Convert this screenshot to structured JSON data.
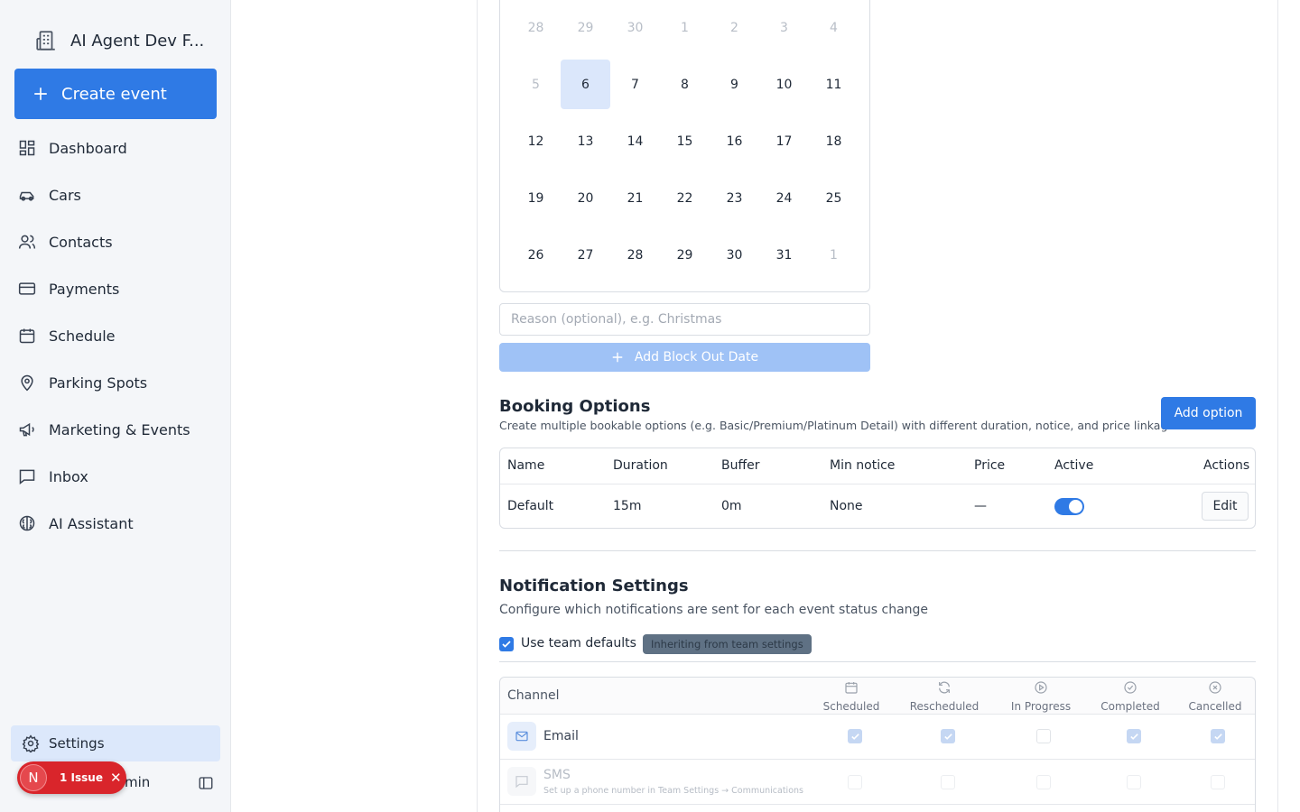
{
  "sidebar": {
    "org_name": "AI Agent Dev F...",
    "create_label": "Create event",
    "items": [
      {
        "label": "Dashboard",
        "icon": "dashboard-icon"
      },
      {
        "label": "Cars",
        "icon": "car-icon"
      },
      {
        "label": "Contacts",
        "icon": "users-icon"
      },
      {
        "label": "Payments",
        "icon": "credit-card-icon"
      },
      {
        "label": "Schedule",
        "icon": "calendar-icon"
      },
      {
        "label": "Parking Spots",
        "icon": "map-pin-icon"
      },
      {
        "label": "Marketing & Events",
        "icon": "megaphone-icon"
      },
      {
        "label": "Inbox",
        "icon": "message-icon"
      },
      {
        "label": "AI Assistant",
        "icon": "brain-icon"
      }
    ],
    "settings_label": "Settings",
    "user_suffix": "min",
    "issue": {
      "initial": "N",
      "label": "1 Issue",
      "close": "✕"
    }
  },
  "calendar": {
    "rows": [
      [
        {
          "d": "28",
          "m": true
        },
        {
          "d": "29",
          "m": true
        },
        {
          "d": "30",
          "m": true
        },
        {
          "d": "1",
          "m": true
        },
        {
          "d": "2",
          "m": true
        },
        {
          "d": "3",
          "m": true
        },
        {
          "d": "4",
          "m": true
        }
      ],
      [
        {
          "d": "5",
          "m": true
        },
        {
          "d": "6",
          "sel": true
        },
        {
          "d": "7"
        },
        {
          "d": "8"
        },
        {
          "d": "9"
        },
        {
          "d": "10"
        },
        {
          "d": "11"
        }
      ],
      [
        {
          "d": "12"
        },
        {
          "d": "13"
        },
        {
          "d": "14"
        },
        {
          "d": "15"
        },
        {
          "d": "16"
        },
        {
          "d": "17"
        },
        {
          "d": "18"
        }
      ],
      [
        {
          "d": "19"
        },
        {
          "d": "20"
        },
        {
          "d": "21"
        },
        {
          "d": "22"
        },
        {
          "d": "23"
        },
        {
          "d": "24"
        },
        {
          "d": "25"
        }
      ],
      [
        {
          "d": "26"
        },
        {
          "d": "27"
        },
        {
          "d": "28"
        },
        {
          "d": "29"
        },
        {
          "d": "30"
        },
        {
          "d": "31"
        },
        {
          "d": "1",
          "m": true
        }
      ]
    ]
  },
  "blockout": {
    "reason_placeholder": "Reason (optional), e.g. Christmas",
    "reason_value": "",
    "add_label": "Add Block Out Date"
  },
  "booking": {
    "title": "Booking Options",
    "subtitle": "Create multiple bookable options (e.g. Basic/Premium/Platinum Detail) with different duration, notice, and price linkage.",
    "add_label": "Add option",
    "columns": [
      "Name",
      "Duration",
      "Buffer",
      "Min notice",
      "Price",
      "Active",
      "Actions"
    ],
    "rows": [
      {
        "name": "Default",
        "duration": "15m",
        "buffer": "0m",
        "min_notice": "None",
        "price": "—",
        "active": true,
        "action": "Edit"
      }
    ]
  },
  "notifications": {
    "title": "Notification Settings",
    "subtitle": "Configure which notifications are sent for each event status change",
    "use_defaults_label": "Use team defaults",
    "use_defaults_checked": true,
    "inherit_badge": "Inheriting from team settings",
    "channel_header": "Channel",
    "statuses": [
      {
        "label": "Scheduled",
        "icon": "calendar-icon"
      },
      {
        "label": "Rescheduled",
        "icon": "refresh-icon"
      },
      {
        "label": "In Progress",
        "icon": "play-circle-icon"
      },
      {
        "label": "Completed",
        "icon": "check-circle-icon"
      },
      {
        "label": "Cancelled",
        "icon": "x-circle-icon"
      }
    ],
    "channels": [
      {
        "name": "Email",
        "icon": "mail-icon",
        "note": "",
        "enabled": true,
        "checks": [
          true,
          true,
          false,
          true,
          true
        ]
      },
      {
        "name": "SMS",
        "icon": "chat-icon",
        "note": "Set up a phone number in Team Settings → Communications",
        "enabled": false,
        "checks": [
          false,
          false,
          false,
          false,
          false
        ]
      }
    ]
  },
  "colors": {
    "accent": "#2f7ae5",
    "selected_day": "#dbe7fb",
    "issue_red": "#d9252b"
  }
}
